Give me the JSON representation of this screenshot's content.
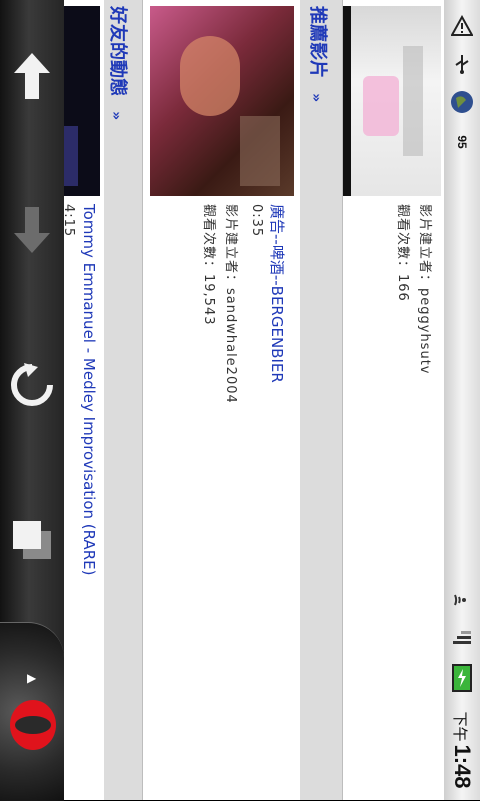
{
  "status_bar": {
    "time": "1:48",
    "ampm": "下午",
    "battery_level": "95"
  },
  "toolbar": {
    "icons": [
      "back-arrow-icon",
      "forward-arrow-icon",
      "reload-icon",
      "tabs-icon",
      "opera-logo-icon"
    ]
  },
  "prev_video": {
    "creator": "影片建立者：peggyhsutv",
    "views": "觀看次數：166"
  },
  "recommended": {
    "heading": "推薦影片",
    "more": "»",
    "video": {
      "title": "廣告--啤酒--BERGENBIER",
      "duration": "0:35",
      "creator": "影片建立者：sandwhale2004",
      "views": "觀看次數：19,543"
    }
  },
  "friends": {
    "heading": "好友的動態",
    "more": "»",
    "video": {
      "duration": "4:15",
      "title": "Tommy Emmanuel - Medley Improvisation (RARE)"
    }
  },
  "colors": {
    "link": "#1f39b8",
    "section_header_bg": "#dcdcdc",
    "opera_red": "#e0131c"
  }
}
